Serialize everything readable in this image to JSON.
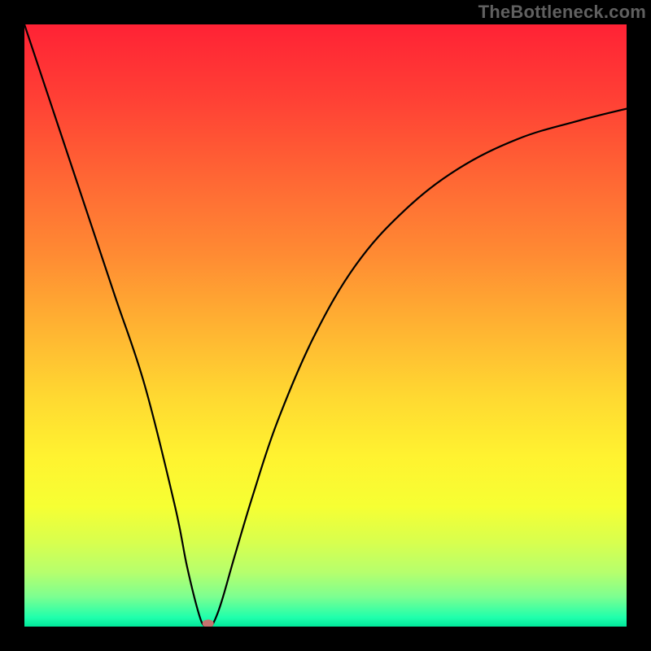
{
  "watermark": "TheBottleneck.com",
  "chart_data": {
    "type": "line",
    "title": "",
    "xlabel": "",
    "ylabel": "",
    "xlim": [
      0,
      100
    ],
    "ylim": [
      0,
      100
    ],
    "grid": false,
    "legend": false,
    "series": [
      {
        "name": "curve",
        "x": [
          0,
          5,
          10,
          15,
          20,
          25,
          27,
          29,
          30,
          31,
          32,
          33,
          35,
          38,
          42,
          48,
          55,
          63,
          72,
          82,
          92,
          100
        ],
        "y": [
          100,
          85,
          70,
          55,
          40,
          20,
          10,
          2,
          0,
          0,
          2,
          5,
          12,
          22,
          34,
          48,
          60,
          69,
          76,
          81,
          84,
          86
        ]
      }
    ],
    "marker": {
      "x": 30.5,
      "y": 0.5,
      "color": "#c5736f"
    },
    "gradient_stops": [
      {
        "offset": 0.0,
        "color": "#ff2235"
      },
      {
        "offset": 0.12,
        "color": "#ff3f35"
      },
      {
        "offset": 0.25,
        "color": "#ff6534"
      },
      {
        "offset": 0.38,
        "color": "#ff8a33"
      },
      {
        "offset": 0.5,
        "color": "#ffb232"
      },
      {
        "offset": 0.62,
        "color": "#ffd931"
      },
      {
        "offset": 0.72,
        "color": "#fff330"
      },
      {
        "offset": 0.8,
        "color": "#f6ff33"
      },
      {
        "offset": 0.86,
        "color": "#d8ff4e"
      },
      {
        "offset": 0.91,
        "color": "#b6ff6d"
      },
      {
        "offset": 0.95,
        "color": "#7dff90"
      },
      {
        "offset": 0.985,
        "color": "#1fffac"
      },
      {
        "offset": 1.0,
        "color": "#00e79a"
      }
    ]
  }
}
